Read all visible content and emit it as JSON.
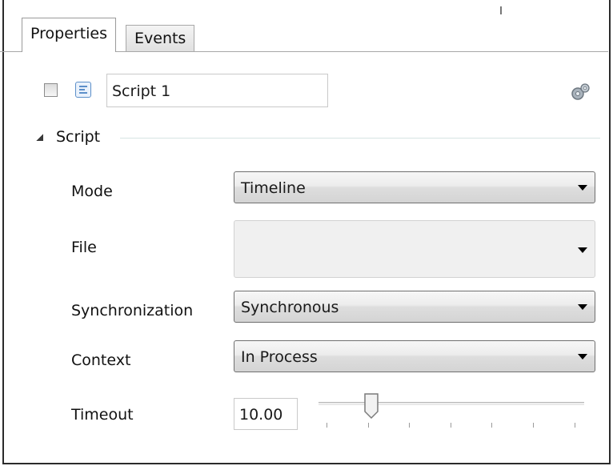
{
  "tabs": [
    {
      "label": "Properties",
      "active": true
    },
    {
      "label": "Events",
      "active": false
    }
  ],
  "header": {
    "enabled_checked": false,
    "name_value": "Script 1"
  },
  "section": {
    "title": "Script",
    "expanded": true
  },
  "fields": {
    "mode": {
      "label": "Mode",
      "value": "Timeline"
    },
    "file": {
      "label": "File",
      "value": ""
    },
    "synchronization": {
      "label": "Synchronization",
      "value": "Synchronous"
    },
    "context": {
      "label": "Context",
      "value": "In Process"
    },
    "timeout": {
      "label": "Timeout",
      "value": "10.00",
      "slider_fraction": 0.18
    }
  },
  "icons": {
    "script": "script-icon",
    "settings": "gear-icon",
    "collapse": "triangle-down-icon"
  }
}
